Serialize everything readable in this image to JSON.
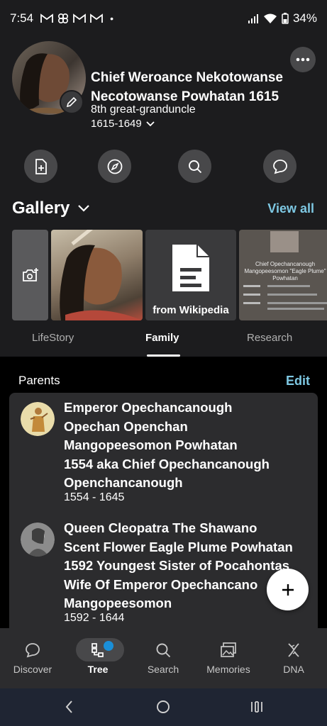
{
  "status": {
    "time": "7:54",
    "battery": "34%",
    "dot": "•"
  },
  "person": {
    "name_line1": "Chief Weroance Nekotowanse",
    "name_line2": "Necotowanse Powhatan 1615",
    "relationship": "8th great-granduncle",
    "dates": "1615-1649"
  },
  "actions": [
    "add-document-icon",
    "compass-icon",
    "search-icon",
    "chat-icon"
  ],
  "gallery": {
    "title": "Gallery",
    "view_all": "View all",
    "items": {
      "wiki_label": "from Wikipedia",
      "doc_heading": "Chief Opechancanough Mangopeesomon \"Eagle Plume\" Powhatan"
    }
  },
  "tabs": [
    {
      "label": "LifeStory",
      "active": false
    },
    {
      "label": "Family",
      "active": true
    },
    {
      "label": "Research",
      "active": false
    }
  ],
  "family": {
    "section_label": "Parents",
    "edit_label": "Edit",
    "parents": [
      {
        "name_lines": [
          "Emperor Opechancanough",
          "Opechan Openchan",
          "Mangopeesomon Powhatan",
          "1554 aka Chief Opechancanough",
          "Openchancanough"
        ],
        "dates": "1554 - 1645"
      },
      {
        "name_lines": [
          "Queen Cleopatra The Shawano",
          "Scent Flower Eagle Plume Powhatan",
          "1592 Youngest Sister of Pocahontas",
          "Wife Of Emperor Opechancano",
          "Mangopeesomon"
        ],
        "dates": "1592 - 1644"
      }
    ]
  },
  "bottom_nav": [
    {
      "label": "Discover",
      "icon": "discover-icon",
      "active": false
    },
    {
      "label": "Tree",
      "icon": "tree-icon",
      "active": true
    },
    {
      "label": "Search",
      "icon": "search-icon",
      "active": false
    },
    {
      "label": "Memories",
      "icon": "memories-icon",
      "active": false
    },
    {
      "label": "DNA",
      "icon": "dna-icon",
      "active": false
    }
  ],
  "colors": {
    "accent": "#7ec8e3",
    "background": "#1c1c1e",
    "card": "#2c2c2e",
    "notification": "#1a8fd8"
  }
}
